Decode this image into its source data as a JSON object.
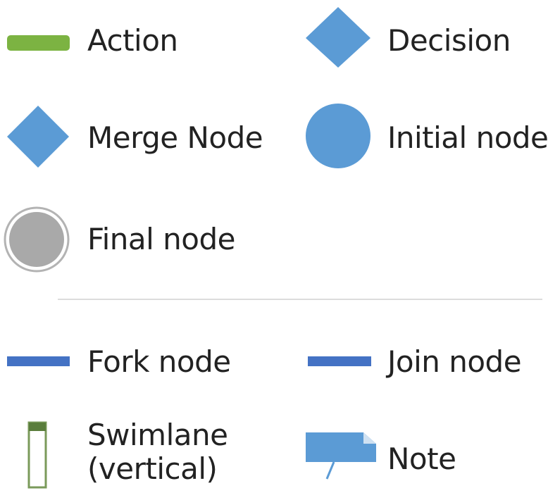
{
  "shapes": {
    "action": {
      "label": "Action",
      "icon": "action-bar-icon",
      "color": "#7cb342"
    },
    "decision": {
      "label": "Decision",
      "icon": "diamond-icon",
      "color": "#5b9bd5"
    },
    "merge_node": {
      "label": "Merge Node",
      "icon": "diamond-icon",
      "color": "#5b9bd5"
    },
    "initial_node": {
      "label": "Initial node",
      "icon": "filled-circle-icon",
      "color": "#5b9bd5"
    },
    "final_node": {
      "label": "Final node",
      "icon": "ringed-circle-icon",
      "color": "#a9a9a9"
    },
    "fork_node": {
      "label": "Fork node",
      "icon": "bar-icon",
      "color": "#4472c4"
    },
    "join_node": {
      "label": "Join node",
      "icon": "bar-icon",
      "color": "#4472c4"
    },
    "swimlane_vertical": {
      "label_line1": "Swimlane",
      "label_line2": "(vertical)",
      "icon": "vertical-swimlane-icon",
      "color": "#5a7d3c"
    },
    "note": {
      "label": "Note",
      "icon": "note-icon",
      "color": "#5b9bd5"
    }
  }
}
